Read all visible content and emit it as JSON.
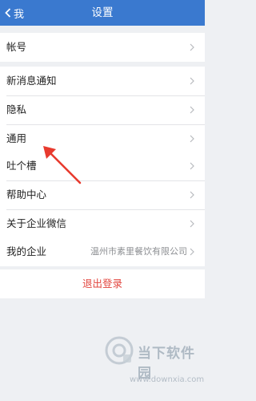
{
  "navbar": {
    "back_label": "我",
    "title": "设置",
    "background_color": "#3a79cf"
  },
  "group_account": {
    "items": [
      {
        "label": "帐号"
      }
    ]
  },
  "group_general": {
    "items": [
      {
        "label": "新消息通知"
      },
      {
        "label": "隐私"
      },
      {
        "label": "通用"
      }
    ]
  },
  "group_help": {
    "items": [
      {
        "label": "吐个槽"
      },
      {
        "label": "帮助中心"
      },
      {
        "label": "关于企业微信"
      }
    ]
  },
  "group_company": {
    "label": "我的企业",
    "value": "温州市素里餐饮有限公司"
  },
  "logout": {
    "label": "退出登录",
    "color": "#e2463f"
  },
  "annotation": {
    "icon": "red-arrow-icon",
    "color": "#e83a2e"
  },
  "watermark": {
    "name": "当下软件园",
    "url": "www.downxia.com"
  }
}
